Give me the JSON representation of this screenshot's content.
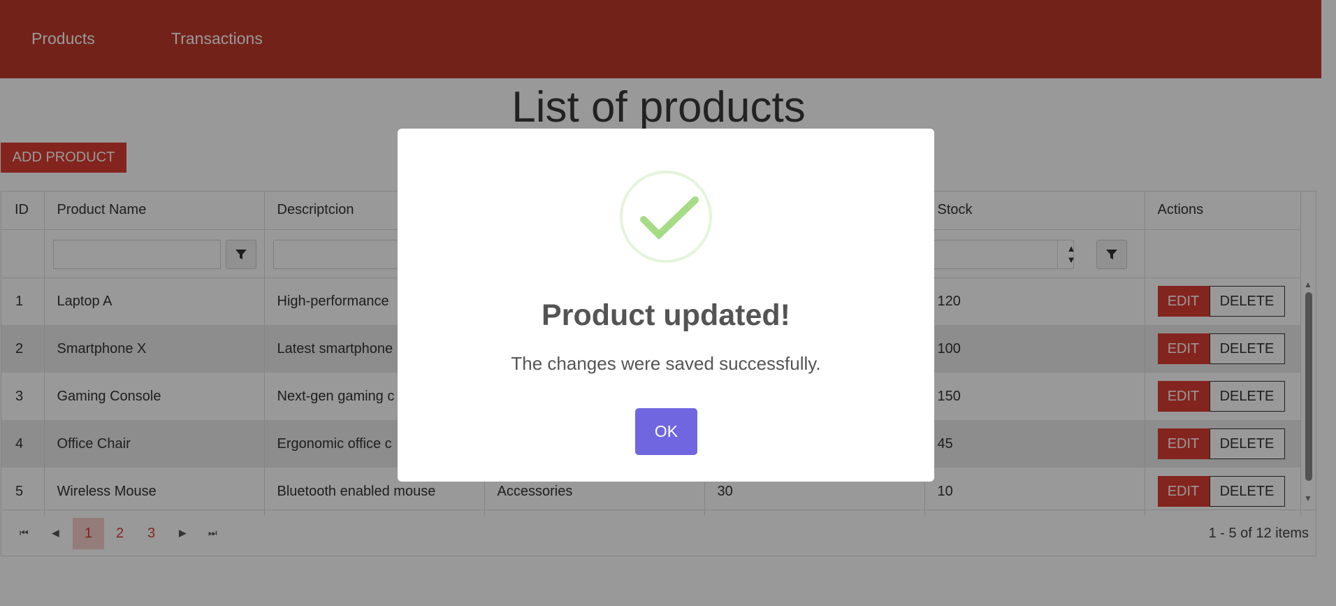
{
  "nav": {
    "products": "Products",
    "transactions": "Transactions"
  },
  "page": {
    "title": "List of products",
    "add_button": "ADD PRODUCT"
  },
  "table": {
    "columns": [
      "ID",
      "Product Name",
      "Descriptcion",
      "",
      "",
      "Stock",
      "Actions"
    ],
    "rows": [
      {
        "id": "1",
        "name": "Laptop A",
        "description": "High-performance",
        "category": "",
        "price": "",
        "stock": "120"
      },
      {
        "id": "2",
        "name": "Smartphone X",
        "description": "Latest smartphone",
        "category": "",
        "price": "",
        "stock": "100"
      },
      {
        "id": "3",
        "name": "Gaming Console",
        "description": "Next-gen gaming c",
        "category": "",
        "price": "",
        "stock": "150"
      },
      {
        "id": "4",
        "name": "Office Chair",
        "description": "Ergonomic office c",
        "category": "",
        "price": "",
        "stock": "45"
      },
      {
        "id": "5",
        "name": "Wireless Mouse",
        "description": "Bluetooth enabled mouse",
        "category": "Accessories",
        "price": "30",
        "stock": "10"
      }
    ],
    "edit_label": "EDIT",
    "delete_label": "DELETE"
  },
  "pager": {
    "pages": [
      "1",
      "2",
      "3"
    ],
    "current_page": "1",
    "info": "1 - 5 of 12 items"
  },
  "modal": {
    "title": "Product updated!",
    "text": "The changes were saved successfully.",
    "ok": "OK",
    "icon": "success-check-icon",
    "icon_color": "#a5dc86",
    "button_color": "#7066e0"
  },
  "colors": {
    "brand": "#c0392b",
    "action": "#dc3d32"
  }
}
